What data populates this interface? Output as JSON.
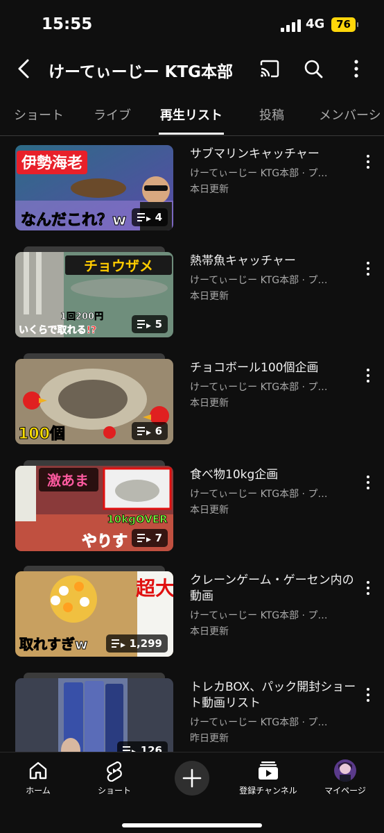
{
  "status": {
    "time": "15:55",
    "network": "4G",
    "battery": "76"
  },
  "header": {
    "title": "けーてぃーじー KTG本部",
    "icons": [
      "back-arrow-icon",
      "cast-icon",
      "search-icon",
      "more-vert-icon"
    ]
  },
  "tabs": [
    {
      "label": "ショート",
      "active": false
    },
    {
      "label": "ライブ",
      "active": false
    },
    {
      "label": "再生リスト",
      "active": true
    },
    {
      "label": "投稿",
      "active": false
    },
    {
      "label": "メンバーシ",
      "active": false
    }
  ],
  "playlists": [
    {
      "title": "サブマリンキャッチャー",
      "channel": "けーてぃーじー KTG本部 · プ…",
      "updated": "本日更新",
      "count": "4",
      "thumb_text": [
        "伊勢海老",
        "なんだこれ？w"
      ]
    },
    {
      "title": "熱帯魚キャッチャー",
      "channel": "けーてぃーじー KTG本部 · プ…",
      "updated": "本日更新",
      "count": "5",
      "thumb_text": [
        "チョウザメ",
        "1回200円",
        "いくらで取れる!?"
      ]
    },
    {
      "title": "チョコボール100個企画",
      "channel": "けーてぃーじー KTG本部 · プ…",
      "updated": "本日更新",
      "count": "6",
      "thumb_text": [
        "100個"
      ]
    },
    {
      "title": "食べ物10kg企画",
      "channel": "けーてぃーじー KTG本部 · プ…",
      "updated": "本日更新",
      "count": "7",
      "thumb_text": [
        "激あま",
        "10kgOVER",
        "やりす"
      ]
    },
    {
      "title": "クレーンゲーム・ゲーセン内の動画",
      "channel": "けーてぃーじー KTG本部 · プ…",
      "updated": "本日更新",
      "count": "1,299",
      "thumb_text": [
        "超大",
        "取れすぎw"
      ]
    },
    {
      "title": "トレカBOX、パック開封ショート動画リスト",
      "channel": "けーてぃーじー KTG本部 · プ…",
      "updated": "昨日更新",
      "count": "126",
      "thumb_text": []
    }
  ],
  "bottom_nav": [
    {
      "label": "ホーム",
      "icon": "home-icon"
    },
    {
      "label": "ショート",
      "icon": "shorts-icon"
    },
    {
      "label": "",
      "icon": "create-plus-icon"
    },
    {
      "label": "登録チャンネル",
      "icon": "subscriptions-icon"
    },
    {
      "label": "マイページ",
      "icon": "avatar-icon"
    }
  ]
}
